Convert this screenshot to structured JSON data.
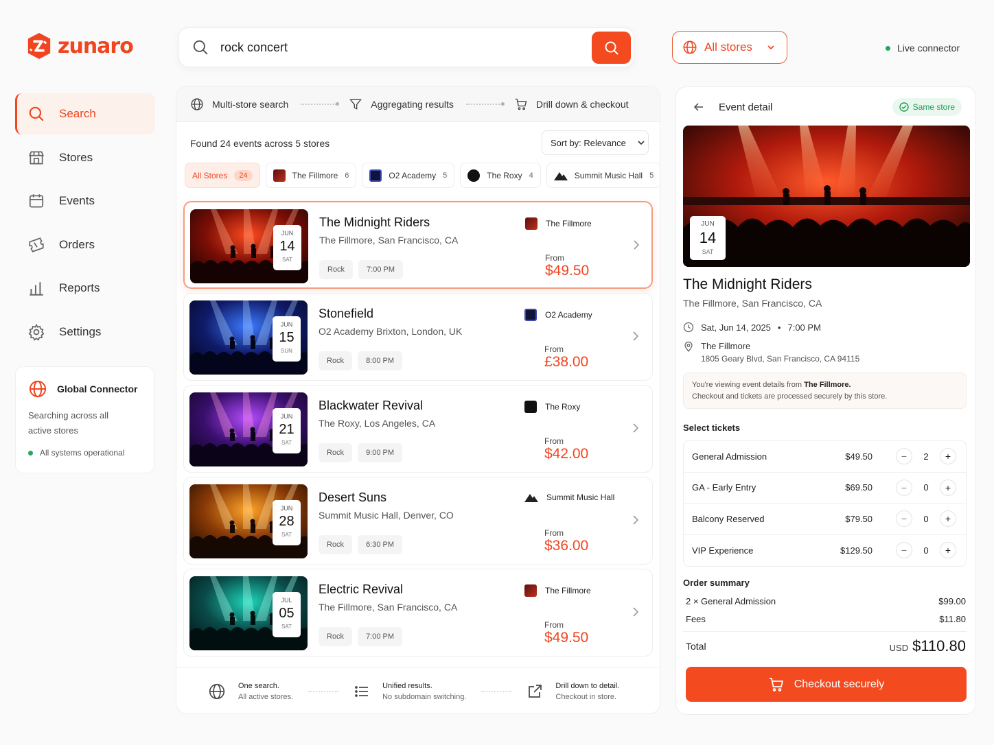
{
  "brand": {
    "name": "zunaro",
    "accent": "#f0451f"
  },
  "search": {
    "query": "rock concert",
    "search_icon": "search-icon"
  },
  "store_selector": {
    "label": "All stores"
  },
  "connector_status": {
    "label": "Live connector"
  },
  "sidebar": {
    "items": [
      {
        "label": "Search",
        "icon": "search-icon",
        "active": true
      },
      {
        "label": "Stores",
        "icon": "store-icon"
      },
      {
        "label": "Events",
        "icon": "calendar-icon"
      },
      {
        "label": "Orders",
        "icon": "ticket-icon"
      },
      {
        "label": "Reports",
        "icon": "bar-chart-icon"
      },
      {
        "label": "Settings",
        "icon": "gear-icon"
      }
    ],
    "connector_card": {
      "title": "Global Connector",
      "desc_line1": "Searching across all",
      "desc_line2": "active stores",
      "status": "All systems operational"
    }
  },
  "steps": {
    "s1": "Multi-store search",
    "s2": "Aggregating results",
    "s3": "Drill down & checkout"
  },
  "results": {
    "found": "Found 24 events across 5 stores",
    "sort_label": "Sort by: Relevance",
    "chips": [
      {
        "label": "All Stores",
        "count": "24"
      },
      {
        "label": "The Fillmore",
        "count": "6"
      },
      {
        "label": "O2 Academy",
        "count": "5"
      },
      {
        "label": "The Roxy",
        "count": "4"
      },
      {
        "label": "Summit Music Hall",
        "count": "5"
      }
    ],
    "events": [
      {
        "title": "The Midnight Riders",
        "venue": "The Fillmore, San Francisco, CA",
        "month": "JUN",
        "day": "14",
        "weekday": "SAT",
        "genre": "Rock",
        "time": "7:00 PM",
        "store": "The Fillmore",
        "from": "From",
        "price": "$49.50",
        "palette": "red"
      },
      {
        "title": "Stonefield",
        "venue": "O2 Academy Brixton, London, UK",
        "month": "JUN",
        "day": "15",
        "weekday": "SUN",
        "genre": "Rock",
        "time": "8:00 PM",
        "store": "O2 Academy",
        "from": "From",
        "price": "£38.00",
        "palette": "blue"
      },
      {
        "title": "Blackwater Revival",
        "venue": "The Roxy, Los Angeles, CA",
        "month": "JUN",
        "day": "21",
        "weekday": "SAT",
        "genre": "Rock",
        "time": "9:00 PM",
        "store": "The Roxy",
        "from": "From",
        "price": "$42.00",
        "palette": "purple"
      },
      {
        "title": "Desert Suns",
        "venue": "Summit Music Hall, Denver, CO",
        "month": "JUN",
        "day": "28",
        "weekday": "SAT",
        "genre": "Rock",
        "time": "6:30 PM",
        "store": "Summit Music Hall",
        "from": "From",
        "price": "$36.00",
        "palette": "orange"
      },
      {
        "title": "Electric Revival",
        "venue": "The Fillmore, San Francisco, CA",
        "month": "JUL",
        "day": "05",
        "weekday": "SAT",
        "genre": "Rock",
        "time": "7:00 PM",
        "store": "The Fillmore",
        "from": "From",
        "price": "$49.50",
        "palette": "teal"
      }
    ],
    "footer": {
      "f1_title": "One search.",
      "f1_sub": "All active stores.",
      "f2_title": "Unified results.",
      "f2_sub": "No subdomain switching.",
      "f3_title": "Drill down to detail.",
      "f3_sub": "Checkout in store."
    }
  },
  "detail": {
    "header": "Event detail",
    "badge": "Same store",
    "month": "JUN",
    "day": "14",
    "weekday": "SAT",
    "title": "The Midnight Riders",
    "venue": "The Fillmore, San Francisco, CA",
    "date": "Sat, Jun 14, 2025",
    "time": "7:00 PM",
    "place": "The Fillmore",
    "address": "1805 Geary Blvd, San Francisco, CA 94115",
    "notice_pre": "You're viewing event details from ",
    "notice_store": "The Fillmore.",
    "notice_line2": "Checkout and tickets are processed securely by this store.",
    "tickets_title": "Select tickets",
    "tickets": [
      {
        "name": "General Admission",
        "price": "$49.50",
        "qty": "2"
      },
      {
        "name": "GA - Early Entry",
        "price": "$69.50",
        "qty": "0"
      },
      {
        "name": "Balcony Reserved",
        "price": "$79.50",
        "qty": "0"
      },
      {
        "name": "VIP Experience",
        "price": "$129.50",
        "qty": "0"
      }
    ],
    "summary_title": "Order summary",
    "summary_item": "2 × General Admission",
    "summary_item_amt": "$99.00",
    "fees_label": "Fees",
    "fees_amt": "$11.80",
    "total_label": "Total",
    "total_currency": "USD",
    "total_amt": "$110.80",
    "checkout_label": "Checkout securely"
  }
}
